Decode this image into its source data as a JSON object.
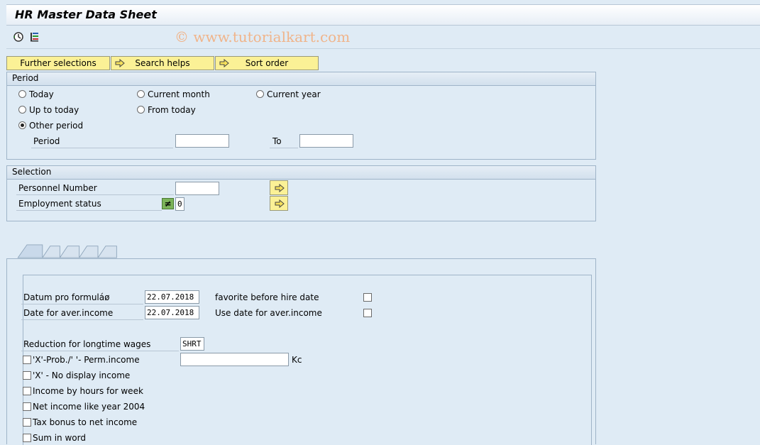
{
  "window": {
    "title": "HR Master Data Sheet"
  },
  "watermark": "© www.tutorialkart.com",
  "toolbar": {
    "icons": [
      "execute-clock-icon",
      "variant-icon"
    ]
  },
  "selection_buttons": [
    {
      "label": "Further selections"
    },
    {
      "label": "Search helps"
    },
    {
      "label": "Sort order"
    }
  ],
  "period": {
    "header": "Period",
    "options": [
      "Today",
      "Current month",
      "Current year",
      "Up to today",
      "From today",
      "Other period"
    ],
    "selected": "Other period",
    "period_label": "Period",
    "to_label": "To",
    "from_value": "",
    "to_value": ""
  },
  "selection": {
    "header": "Selection",
    "personnel_number_label": "Personnel Number",
    "personnel_number_value": "",
    "employment_status_label": "Employment status",
    "employment_status_operator": "≠",
    "employment_status_value": "0"
  },
  "form": {
    "datum_label": "Datum pro formuláø",
    "datum_value": "22.07.2018",
    "aver_date_label": "Date for aver.income",
    "aver_date_value": "22.07.2018",
    "favorite_label": "favorite before hire date",
    "use_date_label": "Use date for aver.income",
    "reduction_label": "Reduction for longtime wages",
    "reduction_value": "SHRT",
    "perm_income_label": "'X'-Prob./' '- Perm.income",
    "perm_income_value": "",
    "currency": "Kc",
    "no_display_label": "'X' - No display income",
    "hours_label": "Income by hours for week",
    "net_income_label": "Net income like year 2004",
    "tax_bonus_label": "Tax bonus to net income",
    "sum_word_label": "Sum in word"
  },
  "colors": {
    "accent_button": "#fbf196",
    "background": "#dfebf5",
    "watermark": "#f0b48a"
  }
}
